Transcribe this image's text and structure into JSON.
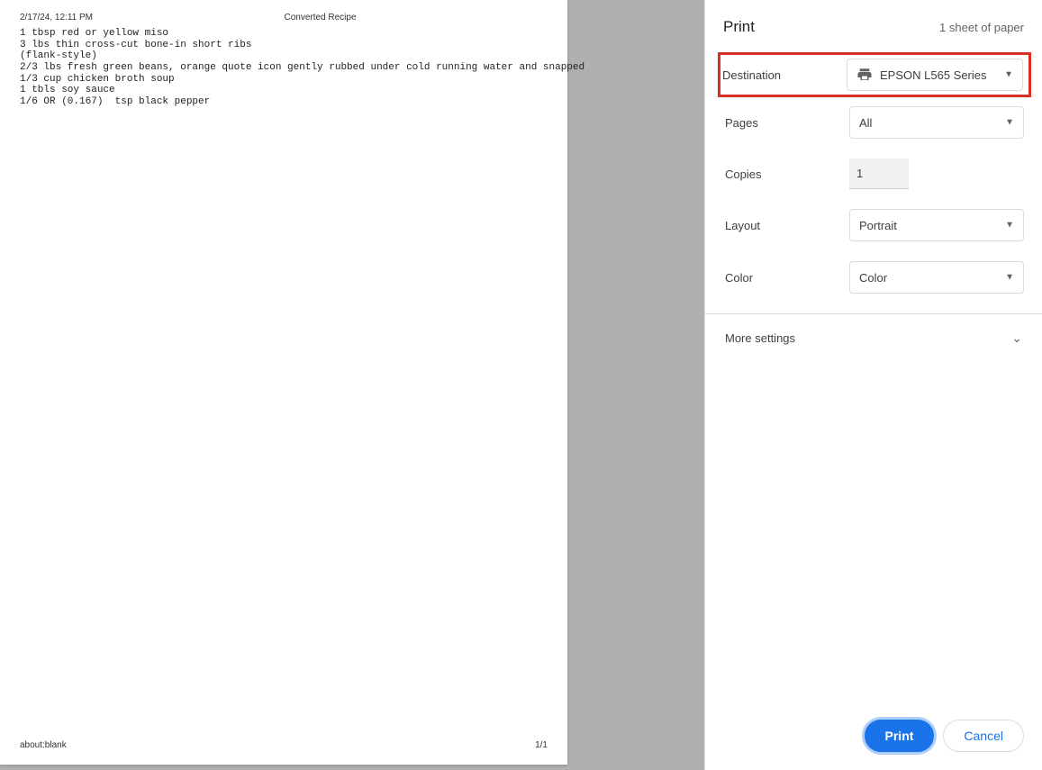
{
  "preview": {
    "header_left": "2/17/24, 12:11 PM",
    "header_center": "Converted Recipe",
    "body_lines": [
      "1 tbsp red or yellow miso",
      "3 lbs thin cross-cut bone-in short ribs",
      "(flank-style)",
      "2/3 lbs fresh green beans, orange quote icon gently rubbed under cold running water and snapped",
      "1/3 cup chicken broth soup",
      "1 tbls soy sauce",
      "1/6 OR (0.167)  tsp black pepper"
    ],
    "footer_left": "about:blank",
    "footer_right": "1/1"
  },
  "sidebar": {
    "title": "Print",
    "sheet_count": "1 sheet of paper",
    "destination": {
      "label": "Destination",
      "value": "EPSON L565 Series"
    },
    "pages": {
      "label": "Pages",
      "value": "All"
    },
    "copies": {
      "label": "Copies",
      "value": "1"
    },
    "layout": {
      "label": "Layout",
      "value": "Portrait"
    },
    "color": {
      "label": "Color",
      "value": "Color"
    },
    "more_settings": "More settings",
    "buttons": {
      "print": "Print",
      "cancel": "Cancel"
    }
  }
}
